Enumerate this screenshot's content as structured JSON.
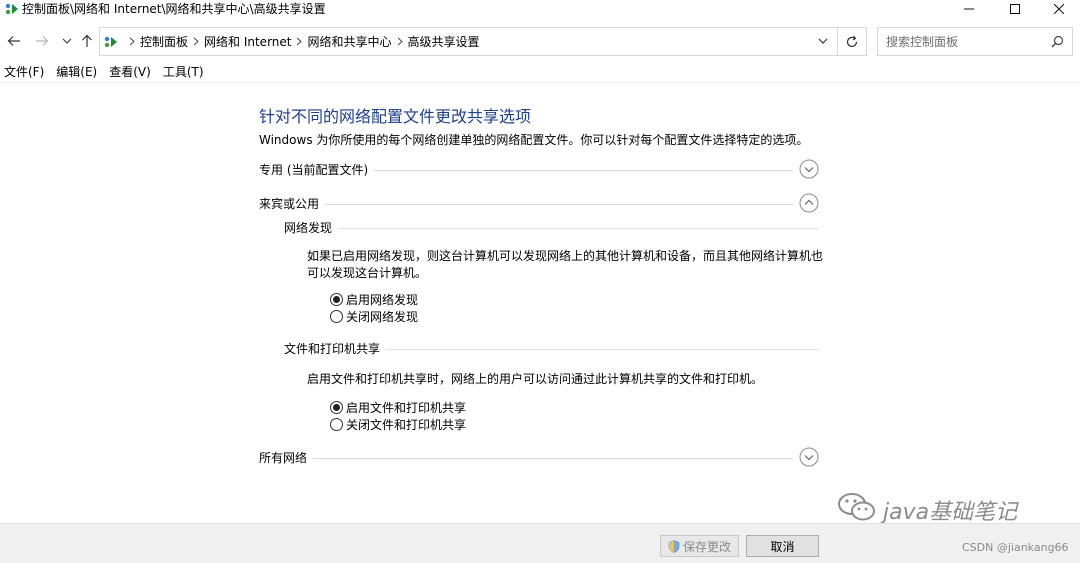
{
  "window": {
    "title": "控制面板\\网络和 Internet\\网络和共享中心\\高级共享设置"
  },
  "address": {
    "crumbs": [
      "控制面板",
      "网络和 Internet",
      "网络和共享中心",
      "高级共享设置"
    ]
  },
  "search": {
    "placeholder": "搜索控制面板"
  },
  "menu": {
    "items": [
      "文件(F)",
      "编辑(E)",
      "查看(V)",
      "工具(T)"
    ]
  },
  "main": {
    "title": "针对不同的网络配置文件更改共享选项",
    "description": "Windows 为你所使用的每个网络创建单独的网络配置文件。你可以针对每个配置文件选择特定的选项。",
    "sections": {
      "private": {
        "label": "专用 (当前配置文件)",
        "expanded": false
      },
      "guest": {
        "label": "来宾或公用",
        "expanded": true
      },
      "all": {
        "label": "所有网络",
        "expanded": false
      }
    },
    "discovery": {
      "label": "网络发现",
      "desc_line1": "如果已启用网络发现，则这台计算机可以发现网络上的其他计算机和设备，而且其他网络计算机也",
      "desc_line2": "可以发现这台计算机。",
      "option_on": "启用网络发现",
      "option_off": "关闭网络发现",
      "selected": "on"
    },
    "sharing": {
      "label": "文件和打印机共享",
      "desc": "启用文件和打印机共享时，网络上的用户可以访问通过此计算机共享的文件和打印机。",
      "option_on": "启用文件和打印机共享",
      "option_off": "关闭文件和打印机共享",
      "selected": "on"
    }
  },
  "footer": {
    "save_label": "保存更改",
    "save_enabled": false,
    "cancel_label": "取消"
  },
  "watermark": {
    "text": "java基础笔记"
  },
  "credit": {
    "text": "CSDN @jiankang66"
  },
  "colors": {
    "title": "#1e3f8f",
    "footer_bg": "#f0f0f0",
    "divider": "#d9d9d9"
  }
}
